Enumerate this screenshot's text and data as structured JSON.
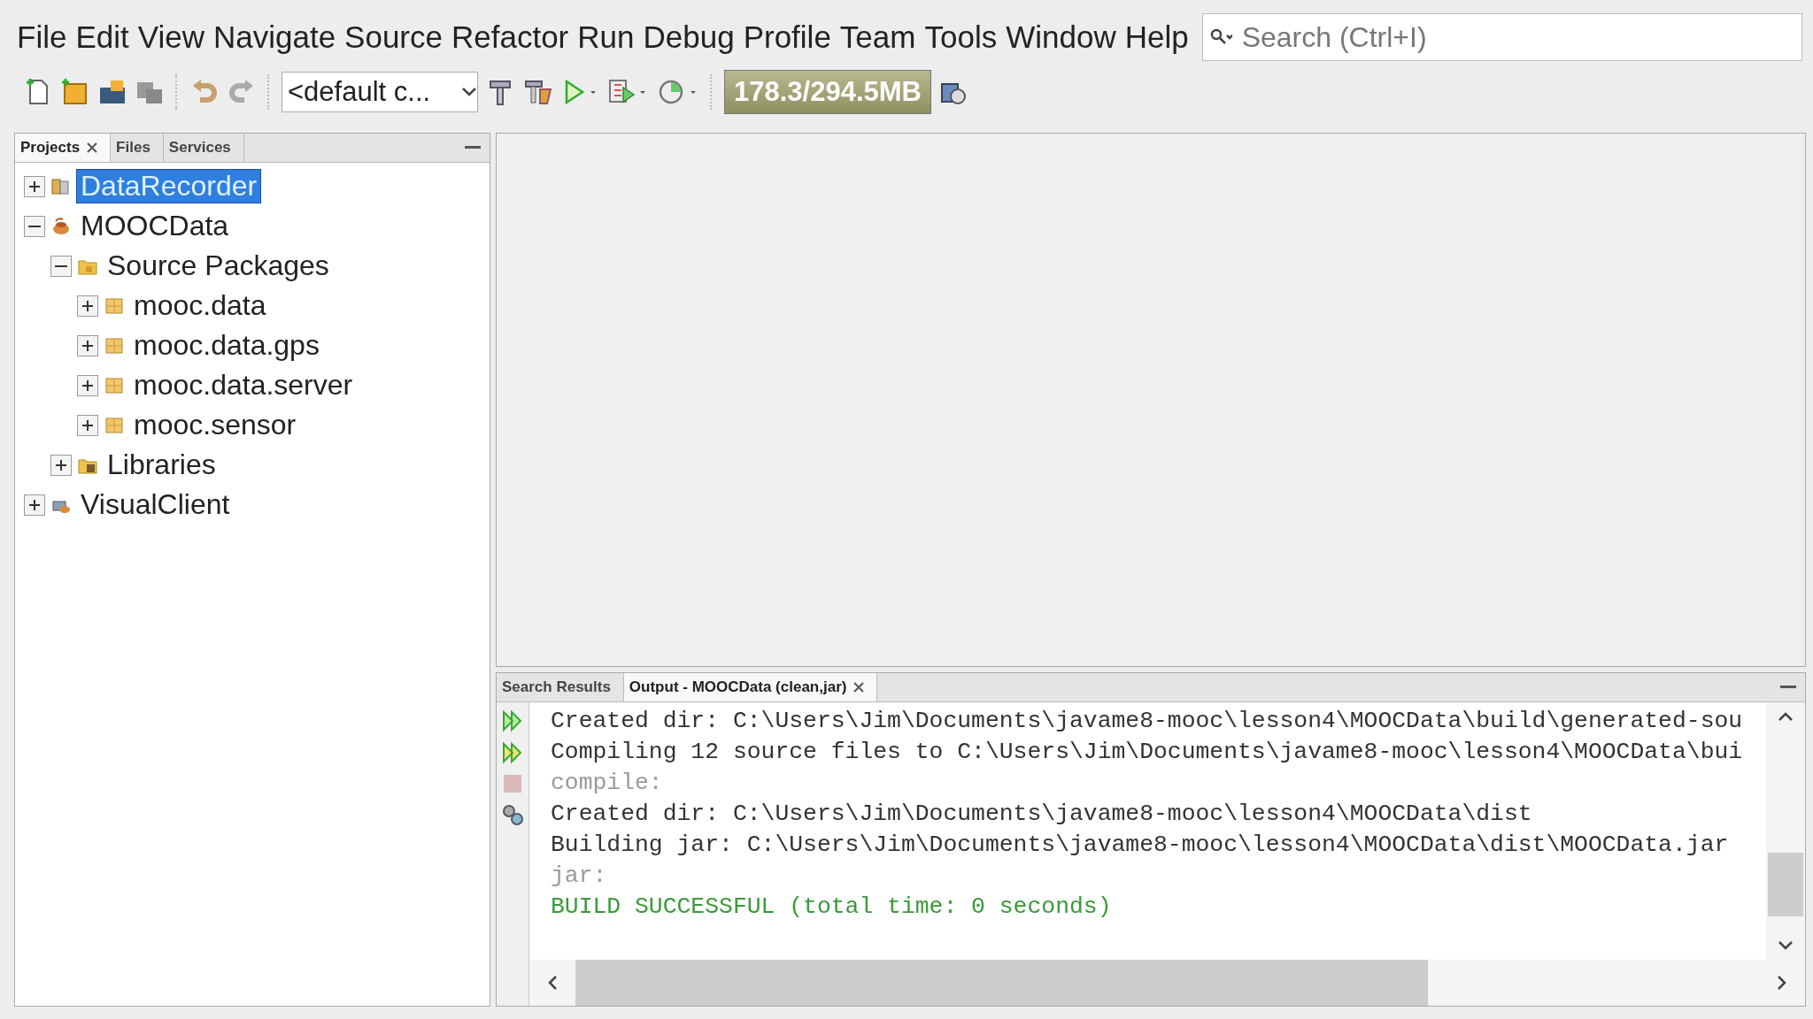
{
  "menu": [
    "File",
    "Edit",
    "View",
    "Navigate",
    "Source",
    "Refactor",
    "Run",
    "Debug",
    "Profile",
    "Team",
    "Tools",
    "Window",
    "Help"
  ],
  "search": {
    "placeholder": "Search (Ctrl+I)"
  },
  "toolbar": {
    "configuration": "<default c...",
    "memory": "178.3/294.5MB"
  },
  "projects_panel": {
    "tabs": [
      {
        "label": "Projects",
        "selected": true,
        "closable": true
      },
      {
        "label": "Files",
        "selected": false,
        "closable": false
      },
      {
        "label": "Services",
        "selected": false,
        "closable": false
      }
    ],
    "tree": [
      {
        "label": "DataRecorder",
        "kind": "library-project",
        "expanded": false,
        "selected": true
      },
      {
        "label": "MOOCData",
        "kind": "project",
        "expanded": true,
        "selected": false,
        "children": [
          {
            "label": "Source Packages",
            "kind": "folder",
            "expanded": true,
            "selected": false,
            "children": [
              {
                "label": "mooc.data",
                "kind": "package",
                "expanded": false,
                "selected": false
              },
              {
                "label": "mooc.data.gps",
                "kind": "package",
                "expanded": false,
                "selected": false
              },
              {
                "label": "mooc.data.server",
                "kind": "package",
                "expanded": false,
                "selected": false
              },
              {
                "label": "mooc.sensor",
                "kind": "package",
                "expanded": false,
                "selected": false
              }
            ]
          },
          {
            "label": "Libraries",
            "kind": "libraries",
            "expanded": false,
            "selected": false
          }
        ]
      },
      {
        "label": "VisualClient",
        "kind": "client-project",
        "expanded": false,
        "selected": false
      }
    ]
  },
  "output_panel": {
    "tabs": [
      {
        "label": "Search Results",
        "selected": false,
        "closable": false
      },
      {
        "label": "Output - MOOCData (clean,jar)",
        "selected": true,
        "closable": true
      }
    ],
    "lines": [
      {
        "text": "Created dir: C:\\Users\\Jim\\Documents\\javame8-mooc\\lesson4\\MOOCData\\build\\generated-sou",
        "kind": "log"
      },
      {
        "text": "Compiling 12 source files to C:\\Users\\Jim\\Documents\\javame8-mooc\\lesson4\\MOOCData\\bui",
        "kind": "log"
      },
      {
        "text": "compile:",
        "kind": "target"
      },
      {
        "text": "Created dir: C:\\Users\\Jim\\Documents\\javame8-mooc\\lesson4\\MOOCData\\dist",
        "kind": "log"
      },
      {
        "text": "Building jar: C:\\Users\\Jim\\Documents\\javame8-mooc\\lesson4\\MOOCData\\dist\\MOOCData.jar",
        "kind": "log"
      },
      {
        "text": "jar:",
        "kind": "target"
      },
      {
        "text": "BUILD SUCCESSFUL (total time: 0 seconds)",
        "kind": "success"
      }
    ]
  }
}
